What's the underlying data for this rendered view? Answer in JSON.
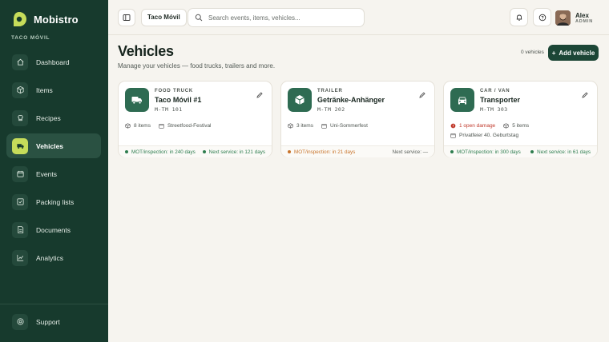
{
  "brand": {
    "name": "Mobistro",
    "account": "TACO MÓVIL"
  },
  "sidebar": {
    "items": [
      {
        "label": "Dashboard",
        "icon": "home-icon",
        "active": false
      },
      {
        "label": "Items",
        "icon": "box-icon",
        "active": false
      },
      {
        "label": "Recipes",
        "icon": "recipe-icon",
        "active": false
      },
      {
        "label": "Vehicles",
        "icon": "truck-icon",
        "active": true
      },
      {
        "label": "Events",
        "icon": "calendar-icon",
        "active": false
      },
      {
        "label": "Packing lists",
        "icon": "checklist-icon",
        "active": false
      },
      {
        "label": "Documents",
        "icon": "document-icon",
        "active": false
      },
      {
        "label": "Analytics",
        "icon": "chart-icon",
        "active": false
      }
    ],
    "support": {
      "label": "Support",
      "icon": "support-icon"
    }
  },
  "topbar": {
    "tenant": "Taco Móvil",
    "search_placeholder": "Search events, items, vehicles...",
    "user": {
      "name": "Alex",
      "role": "ADMIN"
    }
  },
  "page": {
    "title": "Vehicles",
    "subtitle": "Manage your vehicles — food trucks, trailers and more.",
    "count": "0 vehicles",
    "add_label": "Add vehicle"
  },
  "vehicles": [
    {
      "kind": "FOOD TRUCK",
      "name": "Taco Móvil #1",
      "plate": "M-TM 101",
      "items": "8 items",
      "event": "Streetfood-Festival",
      "mot": "MOT/inspection: in 240 days",
      "service": "Next service: in 121 days"
    },
    {
      "kind": "TRAILER",
      "name": "Getränke-Anhänger",
      "plate": "M-TM 202",
      "items": "3 items",
      "event": "Uni-Sommerfest",
      "mot": "MOT/inspection: in 21 days",
      "service": "Next service: —"
    },
    {
      "kind": "CAR / VAN",
      "name": "Transporter",
      "plate": "M-TM 303",
      "damage": "1 open damage",
      "items": "5 items",
      "event": "Privatfeier 40. Geburtstag",
      "mot": "MOT/inspection: in 300 days",
      "service": "Next service: in 61 days"
    }
  ],
  "colors": {
    "sidebar": "#173a2d",
    "accent": "#c6dc5a",
    "primary": "#1c4636",
    "ok": "#2e7d4f",
    "warn": "#c8732a",
    "danger": "#c0392b"
  }
}
